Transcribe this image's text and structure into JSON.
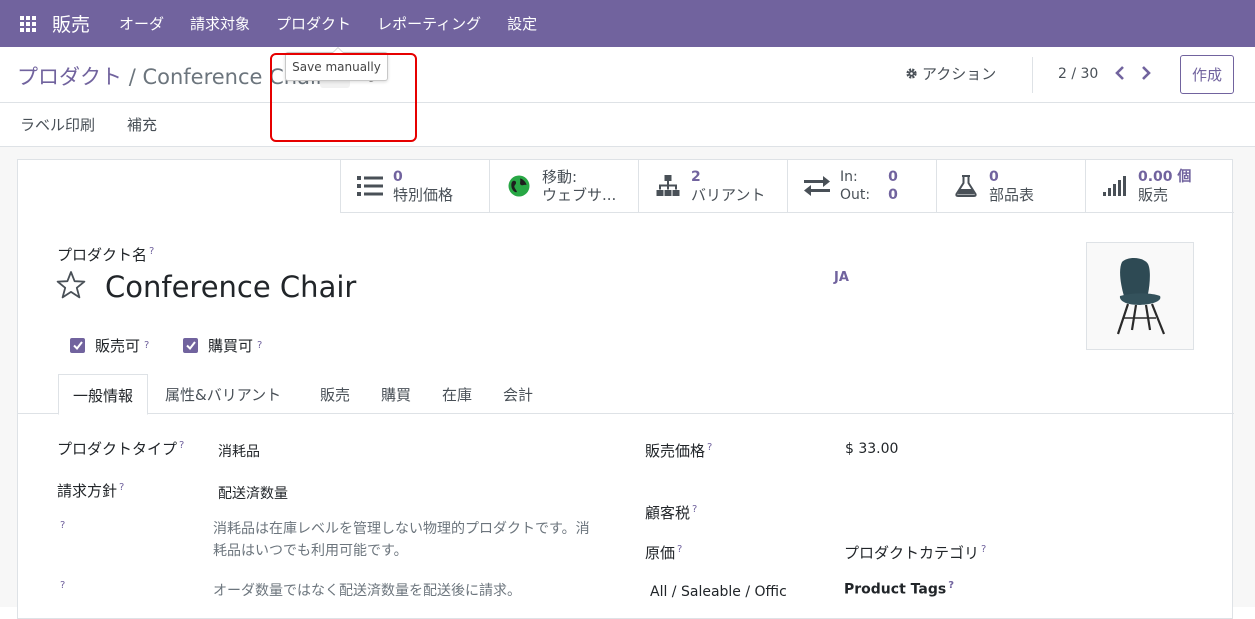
{
  "topnav": {
    "brand": "販売",
    "menu": [
      "オーダ",
      "請求対象",
      "プロダクト",
      "レポーティング",
      "設定"
    ]
  },
  "control": {
    "breadcrumb_parent": "プロダクト",
    "breadcrumb_sep": "/",
    "breadcrumb_current": "Conference Chair",
    "tooltip": "Save manually",
    "action_label": "アクション",
    "pager": "2 / 30",
    "create_label": "作成"
  },
  "statusbar": {
    "buttons": [
      "ラベル印刷",
      "補充"
    ]
  },
  "smart_buttons": [
    {
      "value": "0",
      "label": "特別価格",
      "icon": "list-icon"
    },
    {
      "value": "移動:",
      "label": "ウェブサ...",
      "icon": "globe-icon"
    },
    {
      "value": "2",
      "label": "バリアント",
      "icon": "sitemap-icon"
    },
    {
      "in_label": "In:",
      "in_value": "0",
      "out_label": "Out:",
      "out_value": "0",
      "icon": "exchange-icon"
    },
    {
      "value": "0",
      "label": "部品表",
      "icon": "flask-icon"
    },
    {
      "value": "0.00 個",
      "label": "販売",
      "icon": "signal-icon"
    }
  ],
  "form": {
    "name_label": "プロダクト名",
    "name": "Conference Chair",
    "lang": "JA",
    "sale_ok_label": "販売可",
    "purchase_ok_label": "購買可",
    "tabs": [
      "一般情報",
      "属性&バリアント",
      "販売",
      "購買",
      "在庫",
      "会計"
    ],
    "product_type_label": "プロダクトタイプ",
    "product_type_value": "消耗品",
    "invoice_policy_label": "請求方針",
    "invoice_policy_value": "配送済数量",
    "help_consumable": "消耗品は在庫レベルを管理しない物理的プロダクトです。消耗品はいつでも利用可能です。",
    "help_invoice": "オーダ数量ではなく配送済数量を配送後に請求。",
    "sales_price_label": "販売価格",
    "sales_price_value": "$ 33.00",
    "customer_tax_label": "顧客税",
    "cost_label": "原価",
    "category_label": "プロダクトカテゴリ",
    "category_value": "All / Saleable / Offic",
    "tags_label": "Product Tags"
  },
  "colors": {
    "brand": "#71639e",
    "highlight": "#e60000"
  }
}
